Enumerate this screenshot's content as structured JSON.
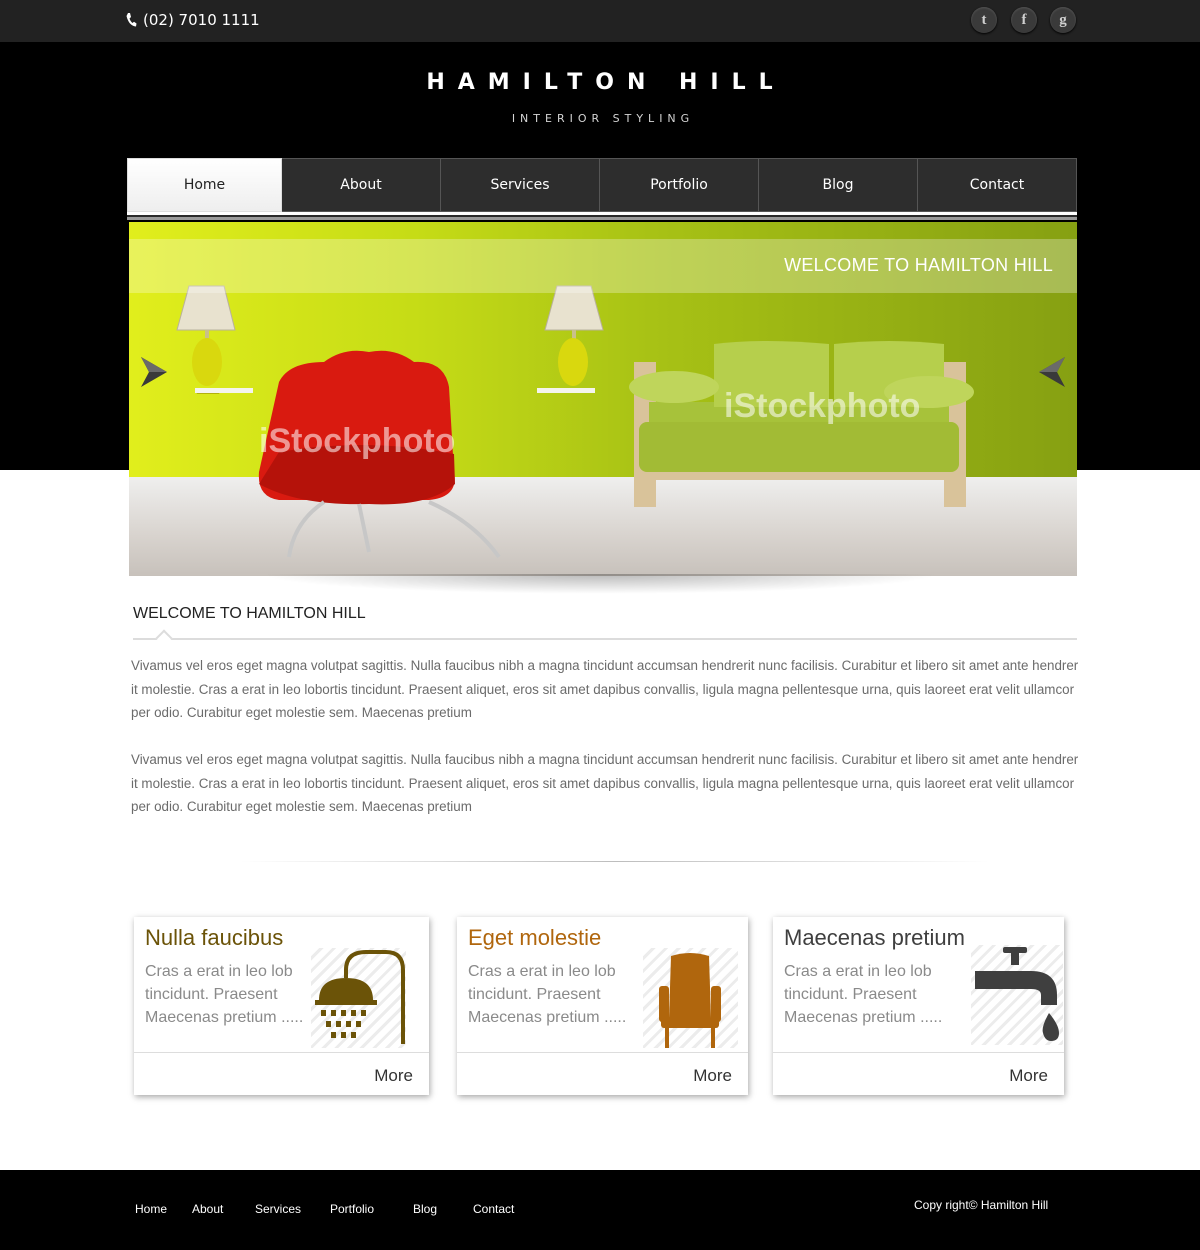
{
  "header": {
    "phone": "(02) 7010 1111",
    "social": [
      {
        "name": "twitter-icon",
        "glyph": "t"
      },
      {
        "name": "facebook-icon",
        "glyph": "f"
      },
      {
        "name": "google-icon",
        "glyph": "g"
      }
    ],
    "logo": "HAMILTON HILL",
    "tagline": "INTERIOR STYLING"
  },
  "nav": {
    "items": [
      "Home",
      "About",
      "Services",
      "Portfolio",
      "Blog",
      "Contact"
    ],
    "active": "Home"
  },
  "slider": {
    "caption": "WELCOME TO HAMILTON HILL",
    "watermark": "iStockphoto"
  },
  "welcome": {
    "title": "WELCOME TO HAMILTON HILL",
    "paragraphs": [
      "Vivamus vel eros eget magna volutpat sagittis. Nulla faucibus nibh a magna tincidunt accumsan hendrerit nunc facilisis. Curabitur et libero sit amet ante hendrerit molestie. Cras a erat in leo lobortis tincidunt. Praesent aliquet, eros sit amet dapibus convallis, ligula magna pellentesque urna, quis laoreet erat velit ullamcorper odio. Curabitur eget molestie sem. Maecenas pretium",
      "Vivamus vel eros eget magna volutpat sagittis. Nulla faucibus nibh a magna tincidunt accumsan hendrerit nunc facilisis. Curabitur et libero sit amet ante hendrerit molestie. Cras a erat in leo lobortis tincidunt. Praesent aliquet, eros sit amet dapibus convallis, ligula magna pellentesque urna, quis laoreet erat velit ullamcorper odio. Curabitur eget molestie sem. Maecenas pretium"
    ]
  },
  "cards": [
    {
      "title": "Nulla faucibus",
      "text": "Cras a erat in leo lob tincidunt. Praesent Maecenas pretium .....",
      "more": "More",
      "icon": "shower-icon",
      "color": "#6b5308"
    },
    {
      "title": "Eget molestie",
      "text": "Cras a erat in leo lob tincidunt. Praesent Maecenas pretium .....",
      "more": "More",
      "icon": "armchair-icon",
      "color": "#b0660d"
    },
    {
      "title": "Maecenas pretium",
      "text": "Cras a erat in leo lob tincidunt. Praesent Maecenas pretium .....",
      "more": "More",
      "icon": "faucet-icon",
      "color": "#3f3f3f"
    }
  ],
  "footer": {
    "links": [
      "Home",
      "About",
      "Services",
      "Portfolio",
      "Blog",
      "Contact"
    ],
    "copyright": "Copy right© Hamilton Hill"
  },
  "colors": {
    "topbar": "#222222",
    "nav": "#2d2d2d",
    "slider_green": "#a6c21e",
    "sofa_green": "#a7c23a",
    "chair_red": "#d91a10"
  }
}
